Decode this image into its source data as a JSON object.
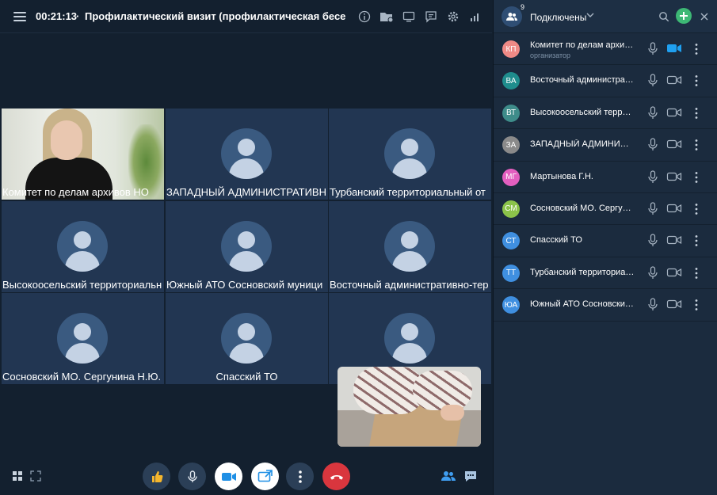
{
  "conference": {
    "timer": "00:21:13",
    "separator": "·",
    "title": "Профилактический визит (профилактическая бесе..."
  },
  "tiles": [
    {
      "name": "Комитет по делам архивов НО",
      "has_video": true
    },
    {
      "name": "ЗАПАДНЫЙ АДМИНИСТРАТИВН",
      "has_video": false
    },
    {
      "name": "Турбанский территориальный от",
      "has_video": false
    },
    {
      "name": "Высокоосельский территориальн",
      "has_video": false
    },
    {
      "name": "Южный АТО Сосновский муници",
      "has_video": false
    },
    {
      "name": "Восточный административно-тер",
      "has_video": false
    },
    {
      "name": "Сосновский МО. Сергунина Н.Ю.",
      "has_video": false
    },
    {
      "name": "Спасский ТО",
      "has_video": false
    },
    {
      "name": "",
      "has_video": false
    }
  ],
  "panel": {
    "title": "Подключены",
    "count": "9"
  },
  "participants": [
    {
      "initials": "КП",
      "name": "Комитет по делам архив...",
      "role": "организатор",
      "color": "#ef8a86",
      "cam_on": true
    },
    {
      "initials": "ВА",
      "name": "Восточный администрат...",
      "role": "",
      "color": "#1f8d8d",
      "cam_on": false
    },
    {
      "initials": "ВТ",
      "name": "Высокоосельский террит...",
      "role": "",
      "color": "#3e8c8a",
      "cam_on": false
    },
    {
      "initials": "ЗА",
      "name": "ЗАПАДНЫЙ АДМИНИСТР...",
      "role": "",
      "color": "#8a8a8a",
      "cam_on": false
    },
    {
      "initials": "МГ",
      "name": "Мартынова Г.Н.",
      "role": "",
      "color": "#e35fbf",
      "cam_on": false
    },
    {
      "initials": "СМ",
      "name": "Сосновский МО. Сергуни...",
      "role": "",
      "color": "#8bc34a",
      "cam_on": false
    },
    {
      "initials": "СТ",
      "name": "Спасский ТО",
      "role": "",
      "color": "#3f8fe0",
      "cam_on": false
    },
    {
      "initials": "ТТ",
      "name": "Турбанский территориал...",
      "role": "",
      "color": "#3f8fe0",
      "cam_on": false
    },
    {
      "initials": "ЮА",
      "name": "Южный АТО Сосновский ...",
      "role": "",
      "color": "#3f8fe0",
      "cam_on": false
    }
  ],
  "icons": {
    "topbar": [
      "menu-icon",
      "info-icon",
      "add-folder-icon",
      "screen-share-icon",
      "chat-bubble-icon",
      "settings-icon",
      "signal-icon"
    ],
    "bottombar": [
      "layout-grid-icon",
      "expand-icon",
      "thumbs-up-icon",
      "microphone-icon",
      "camera-icon",
      "share-screen-icon",
      "more-options-icon",
      "hang-up-icon",
      "participants-icon",
      "chat-icon"
    ]
  },
  "colors": {
    "background": "#13202f",
    "panel": "#1b2b3e",
    "tile": "#223652",
    "accent_green": "#3db875",
    "hangup_red": "#d9363e",
    "camera_on_blue": "#1fa0f0"
  }
}
